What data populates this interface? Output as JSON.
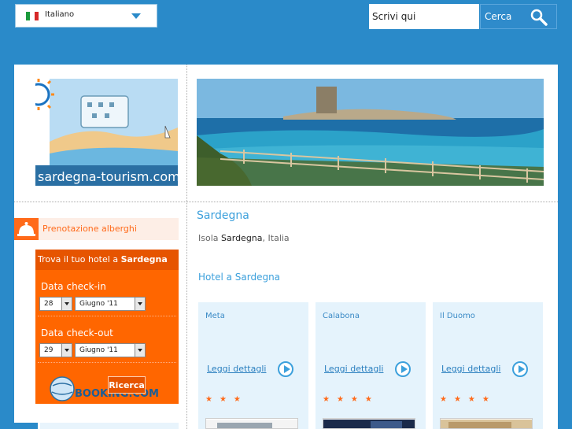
{
  "language": {
    "label": "Italiano",
    "flag": [
      "#1b9a3c",
      "#ffffff",
      "#d62828"
    ]
  },
  "search": {
    "placeholder": "Scrivi qui",
    "value": "Scrivi qui",
    "button_label": "Cerca"
  },
  "logo": {
    "text": "sardegna-tourism.com"
  },
  "booking": {
    "header_label": "Prenotazione alberghi",
    "box_title_prefix": "Trova il tuo hotel a",
    "box_title_place": "Sardegna",
    "checkin_label": "Data check-in",
    "checkin_day": "28",
    "checkin_month": "Giugno '11",
    "checkout_label": "Data check-out",
    "checkout_day": "29",
    "checkout_month": "Giugno '11",
    "search_label": "Ricerca",
    "partner_logo_text": "BOOKING.COM"
  },
  "content": {
    "title": "Sardegna",
    "breadcrumb": {
      "prefix": "Isola",
      "region": "Sardegna",
      "separator": ",",
      "country": "Italia"
    },
    "hotels_heading": "Hotel a Sardegna",
    "hotels": [
      {
        "name": "Meta",
        "link_label": "Leggi dettagli",
        "stars": 3
      },
      {
        "name": "Calabona",
        "link_label": "Leggi dettagli",
        "stars": 4
      },
      {
        "name": "Il Duomo",
        "link_label": "Leggi dettagli",
        "stars": 4
      }
    ]
  },
  "colors": {
    "brand_blue": "#2a8ac9",
    "accent_orange": "#ff6600",
    "link_blue": "#3ca0dc"
  }
}
